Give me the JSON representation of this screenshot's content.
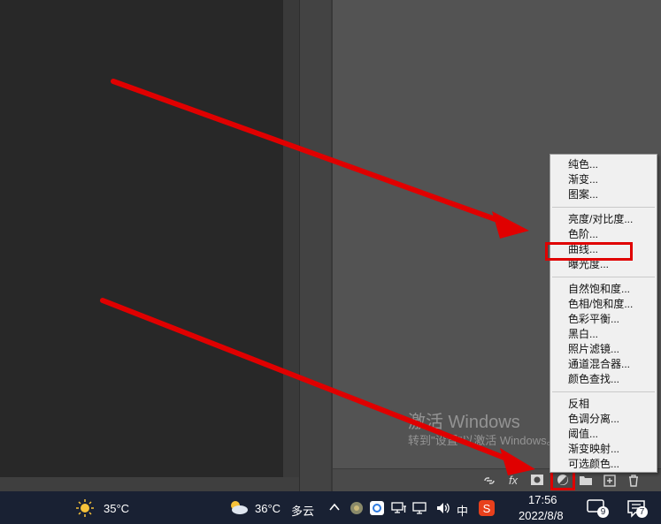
{
  "menu": {
    "group1": [
      "纯色...",
      "渐变...",
      "图案..."
    ],
    "group2": [
      "亮度/对比度...",
      "色阶...",
      "曲线...",
      "曝光度..."
    ],
    "group3": [
      "自然饱和度...",
      "色相/饱和度...",
      "色彩平衡...",
      "黑白...",
      "照片滤镜...",
      "通道混合器...",
      "颜色查找..."
    ],
    "group4": [
      "反相",
      "色调分离...",
      "阈值...",
      "渐变映射...",
      "可选颜色..."
    ]
  },
  "watermark": {
    "line1": "激活 Windows",
    "line2": "转到\"设置\"以激活 Windows。"
  },
  "layers_bar": {
    "fx_label": "fx"
  },
  "taskbar": {
    "weather1_temp": "35°C",
    "weather2_temp": "36°C",
    "weather2_text": "多云",
    "ime_label": "中",
    "time": "17:56",
    "date": "2022/8/8",
    "chat_badge": "9",
    "notify_badge": "7"
  },
  "annotation_color": "#e00000"
}
